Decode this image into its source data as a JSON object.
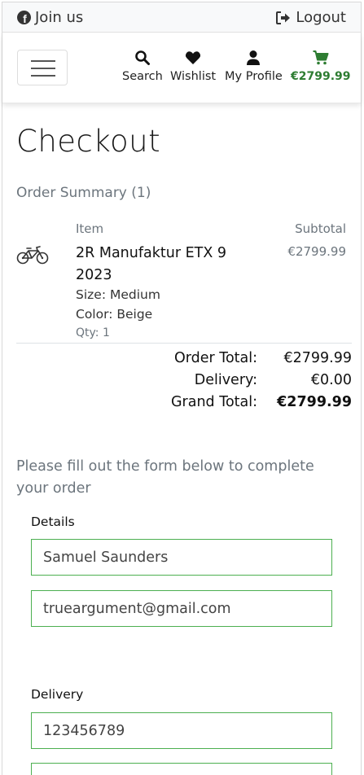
{
  "topbar": {
    "join_label": "Join us",
    "logout_label": "Logout"
  },
  "nav": {
    "search_label": "Search",
    "wishlist_label": "Wishlist",
    "profile_label": "My Profile",
    "bag_total": "€2799.99"
  },
  "page": {
    "title": "Checkout",
    "order_summary": "Order Summary (1)"
  },
  "summary_table": {
    "col_item": "Item",
    "col_subtotal": "Subtotal"
  },
  "product": {
    "name": "2R Manufaktur ETX 9 2023",
    "size": "Size: Medium",
    "color": "Color: Beige",
    "qty": "Qty: 1",
    "price": "€2799.99"
  },
  "totals": {
    "order_total_label": "Order Total:",
    "order_total_value": "€2799.99",
    "delivery_label": "Delivery:",
    "delivery_value": "€0.00",
    "grand_total_label": "Grand Total:",
    "grand_total_value": "€2799.99"
  },
  "form": {
    "instructions": "Please fill out the form below to complete your order",
    "details_legend": "Details",
    "full_name": "Samuel Saunders",
    "email": "trueargument@gmail.com",
    "delivery_legend": "Delivery",
    "phone": "123456789",
    "next_field": ""
  },
  "colors": {
    "accent_green": "#2e7d32",
    "field_border": "#4caf50",
    "muted_text": "#6c757d"
  }
}
